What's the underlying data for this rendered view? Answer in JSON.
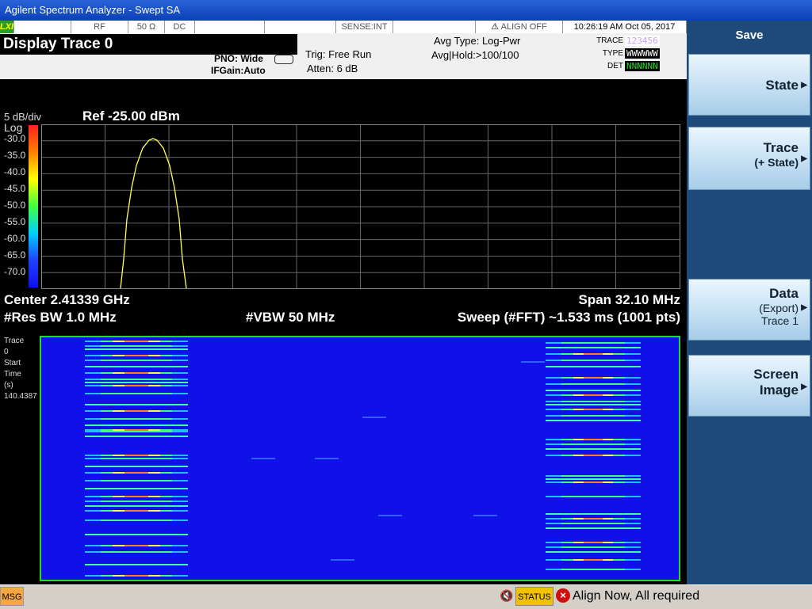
{
  "window": {
    "title": "Agilent Spectrum Analyzer - Swept SA"
  },
  "status_strip": {
    "lxi": "LXI",
    "rf": "RF",
    "impedance": "50 Ω",
    "coupling": "DC",
    "sense": "SENSE:INT",
    "align": "ALIGN OFF",
    "datetime": "10:26:19 AM Oct 05, 2017"
  },
  "header": {
    "display_title": "Display Trace 0",
    "pno": "PNO: Wide",
    "ifgain": "IFGain:Auto",
    "trig": "Trig: Free Run",
    "atten": "Atten: 6 dB",
    "avg_type": "Avg Type: Log-Pwr",
    "avg_hold": "Avg|Hold:>100/100",
    "trace_label": "TRACE",
    "type_label": "TYPE",
    "det_label": "DET",
    "trace_values": "123456",
    "type_values": "WWWWWW",
    "det_values": "NNNNNN"
  },
  "plot": {
    "scale": "5 dB/div",
    "scale_type": "Log",
    "ref": "Ref -25.00 dBm",
    "y_ticks": [
      "-30.0",
      "-35.0",
      "-40.0",
      "-45.0",
      "-50.0",
      "-55.0",
      "-60.0",
      "-65.0",
      "-70.0"
    ],
    "center": "Center 2.41339 GHz",
    "span": "Span 32.10 MHz",
    "res_bw": "#Res BW 1.0 MHz",
    "vbw": "#VBW 50 MHz",
    "sweep": "Sweep (#FFT)  ~1.533 ms (1001 pts)"
  },
  "waterfall": {
    "label_lines": [
      "Trace",
      "0",
      "Start",
      "Time",
      "(s)",
      "140.4387"
    ]
  },
  "softkeys": {
    "save": "Save",
    "state": "State",
    "trace": "Trace",
    "trace_sub": "(+ State)",
    "data": "Data",
    "data_sub1": "(Export)",
    "data_sub2": "Trace 1",
    "screen1": "Screen",
    "screen2": "Image"
  },
  "bottom": {
    "msg": "MSG",
    "status": "STATUS",
    "alert": "Align Now, All required"
  }
}
